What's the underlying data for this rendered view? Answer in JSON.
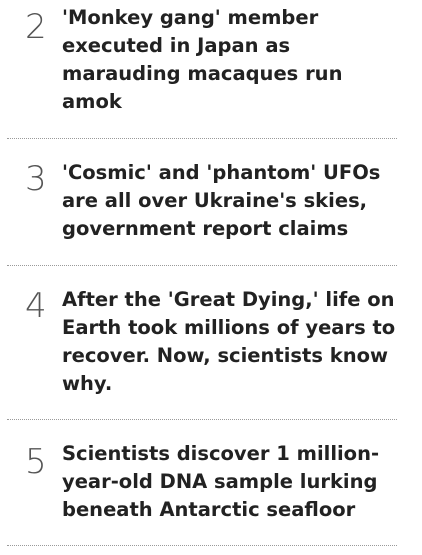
{
  "trending_list": {
    "items": [
      {
        "rank": "2",
        "title_lines": [
          "'Monkey gang' member",
          "executed in Japan as",
          "marauding macaques run",
          "amok"
        ]
      },
      {
        "rank": "3",
        "title_lines": [
          "'Cosmic' and 'phantom' UFOs",
          "are all over Ukraine's skies,",
          "government report claims"
        ]
      },
      {
        "rank": "4",
        "title_lines": [
          "After the 'Great Dying,' life on",
          "Earth took millions of years to",
          "recover. Now, scientists know",
          "why."
        ]
      },
      {
        "rank": "5",
        "title_lines": [
          "Scientists discover 1 million-",
          "year-old DNA sample lurking",
          "beneath Antarctic seafloor"
        ]
      }
    ]
  },
  "colors": {
    "title_text": "#222222",
    "rank_number": "#555555",
    "divider": "#9a9a9a",
    "background": "#ffffff"
  }
}
